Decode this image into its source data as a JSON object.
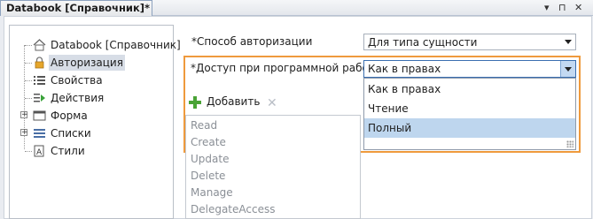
{
  "window": {
    "tab_title": "Databook [Справочник]*",
    "controls": {
      "menu": "▾",
      "pin": "⊓",
      "close": "✕"
    }
  },
  "tree": {
    "items": [
      {
        "label": "Databook [Справочник]",
        "icon": "house-icon",
        "expandable": false,
        "selected": false
      },
      {
        "label": "Авторизация",
        "icon": "lock-icon",
        "expandable": false,
        "selected": true
      },
      {
        "label": "Свойства",
        "icon": "list-icon",
        "expandable": false,
        "selected": false
      },
      {
        "label": "Действия",
        "icon": "play-list-icon",
        "expandable": false,
        "selected": false
      },
      {
        "label": "Форма",
        "icon": "form-icon",
        "expandable": true,
        "selected": false
      },
      {
        "label": "Списки",
        "icon": "lists-icon",
        "expandable": true,
        "selected": false
      },
      {
        "label": "Стили",
        "icon": "style-icon",
        "expandable": false,
        "selected": false
      }
    ]
  },
  "auth": {
    "method_label": "*Способ авторизации",
    "method_value": "Для типа сущности",
    "access_label": "*Доступ при программной работе",
    "access_value": "Как в правах",
    "access_options": [
      "Как в правах",
      "Чтение",
      "Полный"
    ],
    "access_selected_index": 2
  },
  "toolbar": {
    "add_label": "Добавить",
    "delete_icon": "✕"
  },
  "rights_list": [
    "Read",
    "Create",
    "Update",
    "Delete",
    "Manage",
    "DelegateAccess"
  ],
  "colors": {
    "highlight": "#ef9a3d",
    "selected_option": "#bed6ee",
    "add_icon": "#4aa336"
  }
}
